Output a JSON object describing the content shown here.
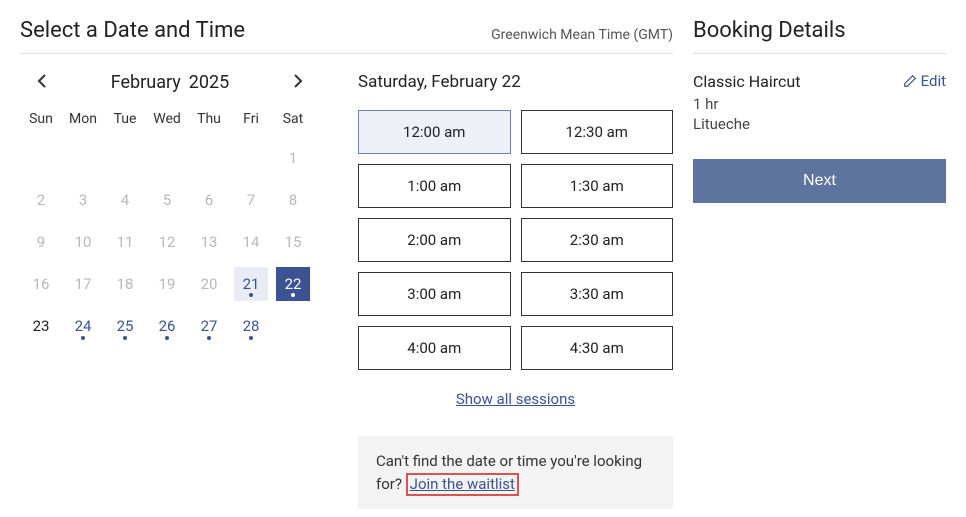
{
  "header": {
    "title": "Select a Date and Time",
    "timezone": "Greenwich Mean Time (GMT)"
  },
  "calendar": {
    "month": "February",
    "year": "2025",
    "dow": [
      "Sun",
      "Mon",
      "Tue",
      "Wed",
      "Thu",
      "Fri",
      "Sat"
    ],
    "weeks": [
      [
        {
          "n": ""
        },
        {
          "n": ""
        },
        {
          "n": ""
        },
        {
          "n": ""
        },
        {
          "n": ""
        },
        {
          "n": ""
        },
        {
          "n": "1",
          "cls": ""
        }
      ],
      [
        {
          "n": "2"
        },
        {
          "n": "3"
        },
        {
          "n": "4"
        },
        {
          "n": "5"
        },
        {
          "n": "6"
        },
        {
          "n": "7"
        },
        {
          "n": "8"
        }
      ],
      [
        {
          "n": "9"
        },
        {
          "n": "10"
        },
        {
          "n": "11"
        },
        {
          "n": "12"
        },
        {
          "n": "13"
        },
        {
          "n": "14"
        },
        {
          "n": "15"
        }
      ],
      [
        {
          "n": "16"
        },
        {
          "n": "17"
        },
        {
          "n": "18"
        },
        {
          "n": "19"
        },
        {
          "n": "20"
        },
        {
          "n": "21",
          "cls": "d21"
        },
        {
          "n": "22",
          "cls": "selected"
        }
      ],
      [
        {
          "n": "23",
          "cls": "today-like"
        },
        {
          "n": "24",
          "cls": "avail"
        },
        {
          "n": "25",
          "cls": "avail"
        },
        {
          "n": "26",
          "cls": "avail"
        },
        {
          "n": "27",
          "cls": "avail"
        },
        {
          "n": "28",
          "cls": "avail"
        },
        {
          "n": ""
        }
      ]
    ]
  },
  "slots": {
    "date_label": "Saturday, February 22",
    "times": [
      {
        "label": "12:00 am",
        "selected": true
      },
      {
        "label": "12:30 am"
      },
      {
        "label": "1:00 am"
      },
      {
        "label": "1:30 am"
      },
      {
        "label": "2:00 am"
      },
      {
        "label": "2:30 am"
      },
      {
        "label": "3:00 am"
      },
      {
        "label": "3:30 am"
      },
      {
        "label": "4:00 am"
      },
      {
        "label": "4:30 am"
      }
    ],
    "show_all": "Show all sessions",
    "waitlist_prompt": "Can't find the date or time you're looking for? ",
    "waitlist_link": "Join the waitlist"
  },
  "details": {
    "title": "Booking Details",
    "service": "Classic Haircut",
    "duration": "1 hr",
    "location": "Litueche",
    "edit_label": "Edit",
    "next_label": "Next"
  }
}
